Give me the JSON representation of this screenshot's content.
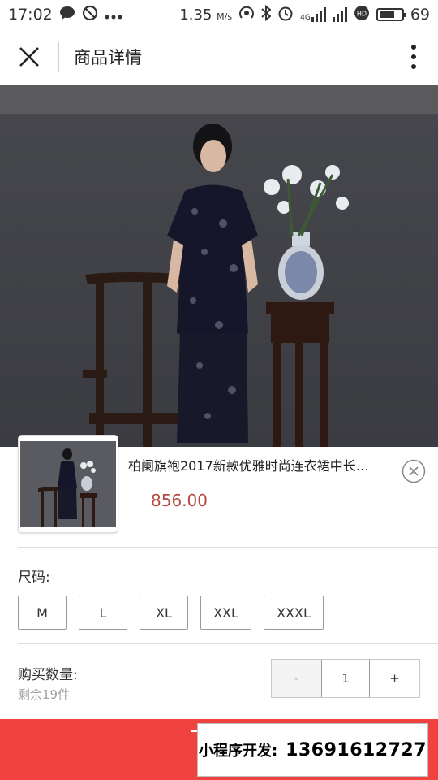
{
  "status_bar": {
    "time": "17:02",
    "network_speed": "1.35",
    "network_speed_unit": "M/s",
    "network_type": "4G",
    "battery_level": 69,
    "battery_text": "69"
  },
  "header": {
    "title": "商品详情",
    "close_icon": "close-icon",
    "more_icon": "more-vertical-icon"
  },
  "product": {
    "name": "柏阑旗袍2017新款优雅时尚连衣裙中长…",
    "price": "856.00",
    "price_color": "#b5493f"
  },
  "size": {
    "label": "尺码:",
    "options": [
      "M",
      "L",
      "XL",
      "XXL",
      "XXXL"
    ]
  },
  "quantity": {
    "label": "购买数量:",
    "stock": "剩余19件",
    "minus": "-",
    "value": "1",
    "plus": "+"
  },
  "bottom": {
    "accent": "#f0423e",
    "dev_label": "小程序开发:",
    "dev_phone": "13691612727"
  }
}
